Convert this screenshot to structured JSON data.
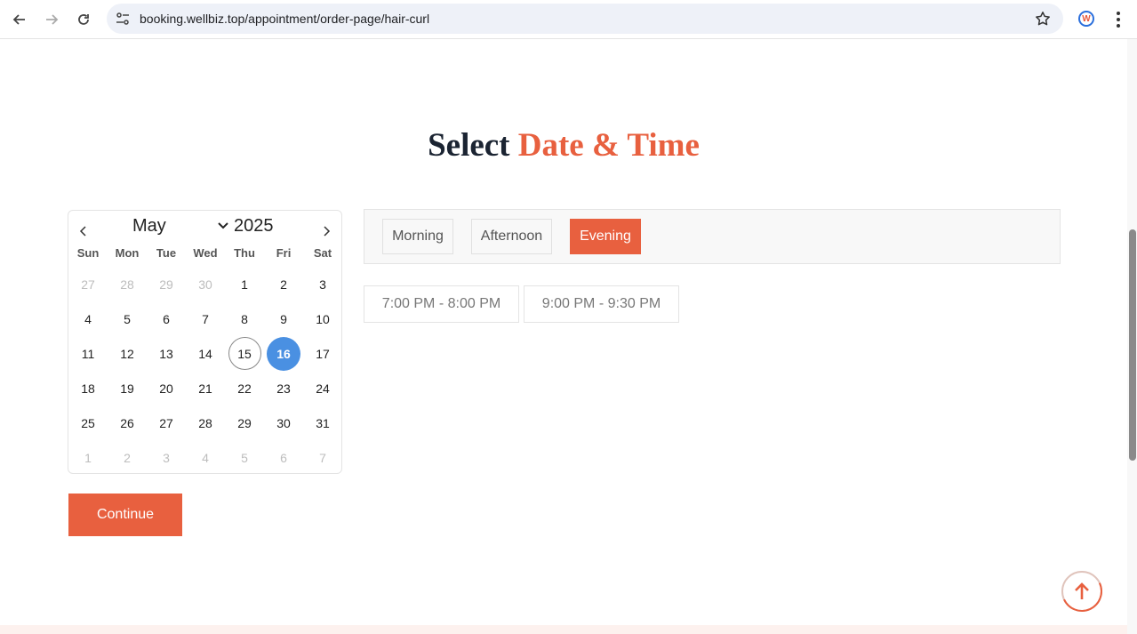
{
  "browser": {
    "url": "booking.wellbiz.top/appointment/order-page/hair-curl",
    "extension_letter": "W"
  },
  "page": {
    "title_part1": "Select",
    "title_part2": "Date & Time"
  },
  "calendar": {
    "month": "May",
    "year": "2025",
    "weekdays": [
      "Sun",
      "Mon",
      "Tue",
      "Wed",
      "Thu",
      "Fri",
      "Sat"
    ],
    "weeks": [
      [
        {
          "d": "27",
          "muted": true
        },
        {
          "d": "28",
          "muted": true
        },
        {
          "d": "29",
          "muted": true
        },
        {
          "d": "30",
          "muted": true
        },
        {
          "d": "1"
        },
        {
          "d": "2"
        },
        {
          "d": "3"
        }
      ],
      [
        {
          "d": "4"
        },
        {
          "d": "5"
        },
        {
          "d": "6"
        },
        {
          "d": "7"
        },
        {
          "d": "8"
        },
        {
          "d": "9"
        },
        {
          "d": "10"
        }
      ],
      [
        {
          "d": "11"
        },
        {
          "d": "12"
        },
        {
          "d": "13"
        },
        {
          "d": "14"
        },
        {
          "d": "15",
          "today": true
        },
        {
          "d": "16",
          "selected": true
        },
        {
          "d": "17"
        }
      ],
      [
        {
          "d": "18"
        },
        {
          "d": "19"
        },
        {
          "d": "20"
        },
        {
          "d": "21"
        },
        {
          "d": "22"
        },
        {
          "d": "23"
        },
        {
          "d": "24"
        }
      ],
      [
        {
          "d": "25"
        },
        {
          "d": "26"
        },
        {
          "d": "27"
        },
        {
          "d": "28"
        },
        {
          "d": "29"
        },
        {
          "d": "30"
        },
        {
          "d": "31"
        }
      ],
      [
        {
          "d": "1",
          "muted": true
        },
        {
          "d": "2",
          "muted": true
        },
        {
          "d": "3",
          "muted": true
        },
        {
          "d": "4",
          "muted": true
        },
        {
          "d": "5",
          "muted": true
        },
        {
          "d": "6",
          "muted": true
        },
        {
          "d": "7",
          "muted": true
        }
      ]
    ]
  },
  "periods": {
    "morning": "Morning",
    "afternoon": "Afternoon",
    "evening": "Evening",
    "active": "Evening"
  },
  "slots": [
    "7:00 PM - 8:00 PM",
    "9:00 PM - 9:30 PM"
  ],
  "actions": {
    "continue_label": "Continue"
  },
  "colors": {
    "accent": "#e8603f",
    "selected_day": "#4a90e2",
    "title_dark": "#1b2432"
  }
}
